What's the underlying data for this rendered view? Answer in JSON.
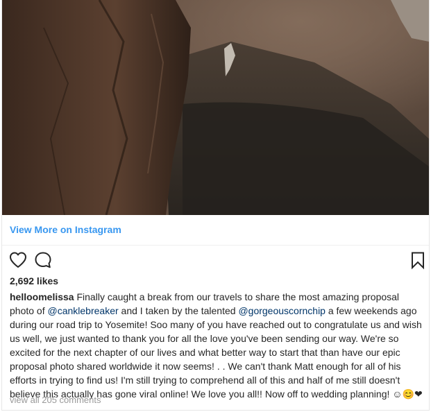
{
  "embed": {
    "photo_alt": "",
    "view_more_label": "View More on Instagram",
    "likes": "2,692 likes",
    "caption": {
      "username": "helloomelissa",
      "text_1": " Finally caught a break from our travels to share the most amazing proposal photo of ",
      "mention_1": "@canklebreaker",
      "text_2": " and I taken by the talented ",
      "mention_2": "@gorgeouscornchip",
      "text_3": " a few weekends ago during our road trip to Yosemite! Soo many of you have reached out to congratulate us and wish us well, we just wanted to thank you for all the love you've been sending our way. We're so excited for the next chapter of our lives and what better way to start that than have our epic proposal photo shared worldwide it now seems! . . We can't thank Matt enough for all of his efforts in trying to find us! I'm still trying to comprehend all of this and half of me still doesn't believe this actually has gone viral online! We love you all!! Now off to wedding planning! ",
      "emoji": "☺😊❤"
    },
    "view_comments_label": "view all 205 comments"
  },
  "icons": {
    "like": "heart-outline-icon",
    "comment": "speech-bubble-icon",
    "save": "bookmark-icon"
  },
  "colors": {
    "link": "#3897f0",
    "mention": "#003569",
    "muted": "#999999",
    "text": "#262626"
  }
}
